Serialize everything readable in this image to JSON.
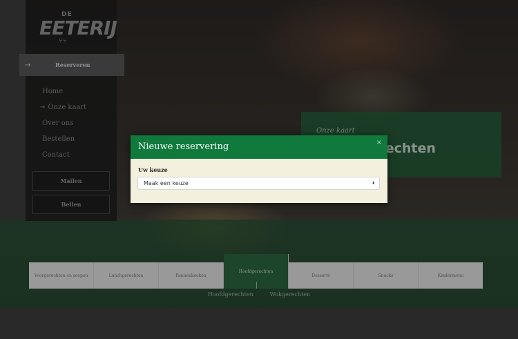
{
  "brand": {
    "logo_prefix": "DE",
    "logo_name": "EETERIJ",
    "logo_sub": "⑂⑂"
  },
  "sidebar": {
    "reserve_button": {
      "arrow": "→",
      "label": "Reserveren"
    },
    "nav": [
      {
        "label": "Home",
        "arrow": ""
      },
      {
        "label": "Onze kaart",
        "arrow": "→"
      },
      {
        "label": "Over ons",
        "arrow": ""
      },
      {
        "label": "Bestellen",
        "arrow": ""
      },
      {
        "label": "Contact",
        "arrow": ""
      }
    ],
    "mail_button": "Mailen",
    "call_button": "Bellen"
  },
  "card": {
    "kicker": "Onze kaart",
    "title": "Hoofdgerechten"
  },
  "tabs": [
    {
      "label": "Voorgerechten en soepen",
      "active": false
    },
    {
      "label": "Lunchgerechten",
      "active": false
    },
    {
      "label": "Pannenkoeken",
      "active": false
    },
    {
      "label": "Hoofdgerechten",
      "active": true
    },
    {
      "label": "Desserts",
      "active": false
    },
    {
      "label": "Snacks",
      "active": false
    },
    {
      "label": "Kindermenu",
      "active": false
    }
  ],
  "subtabs": [
    "Hoofdgerechten",
    "Wokgerechten"
  ],
  "modal": {
    "title": "Nieuwe reservering",
    "close": "×",
    "field_label": "Uw keuze",
    "select_value": "Maak een keuze",
    "select_caret": "⬍"
  },
  "colors": {
    "modal_header": "#0f7a3b",
    "modal_body": "#f3f0de",
    "active_tab": "#2d6b43"
  }
}
